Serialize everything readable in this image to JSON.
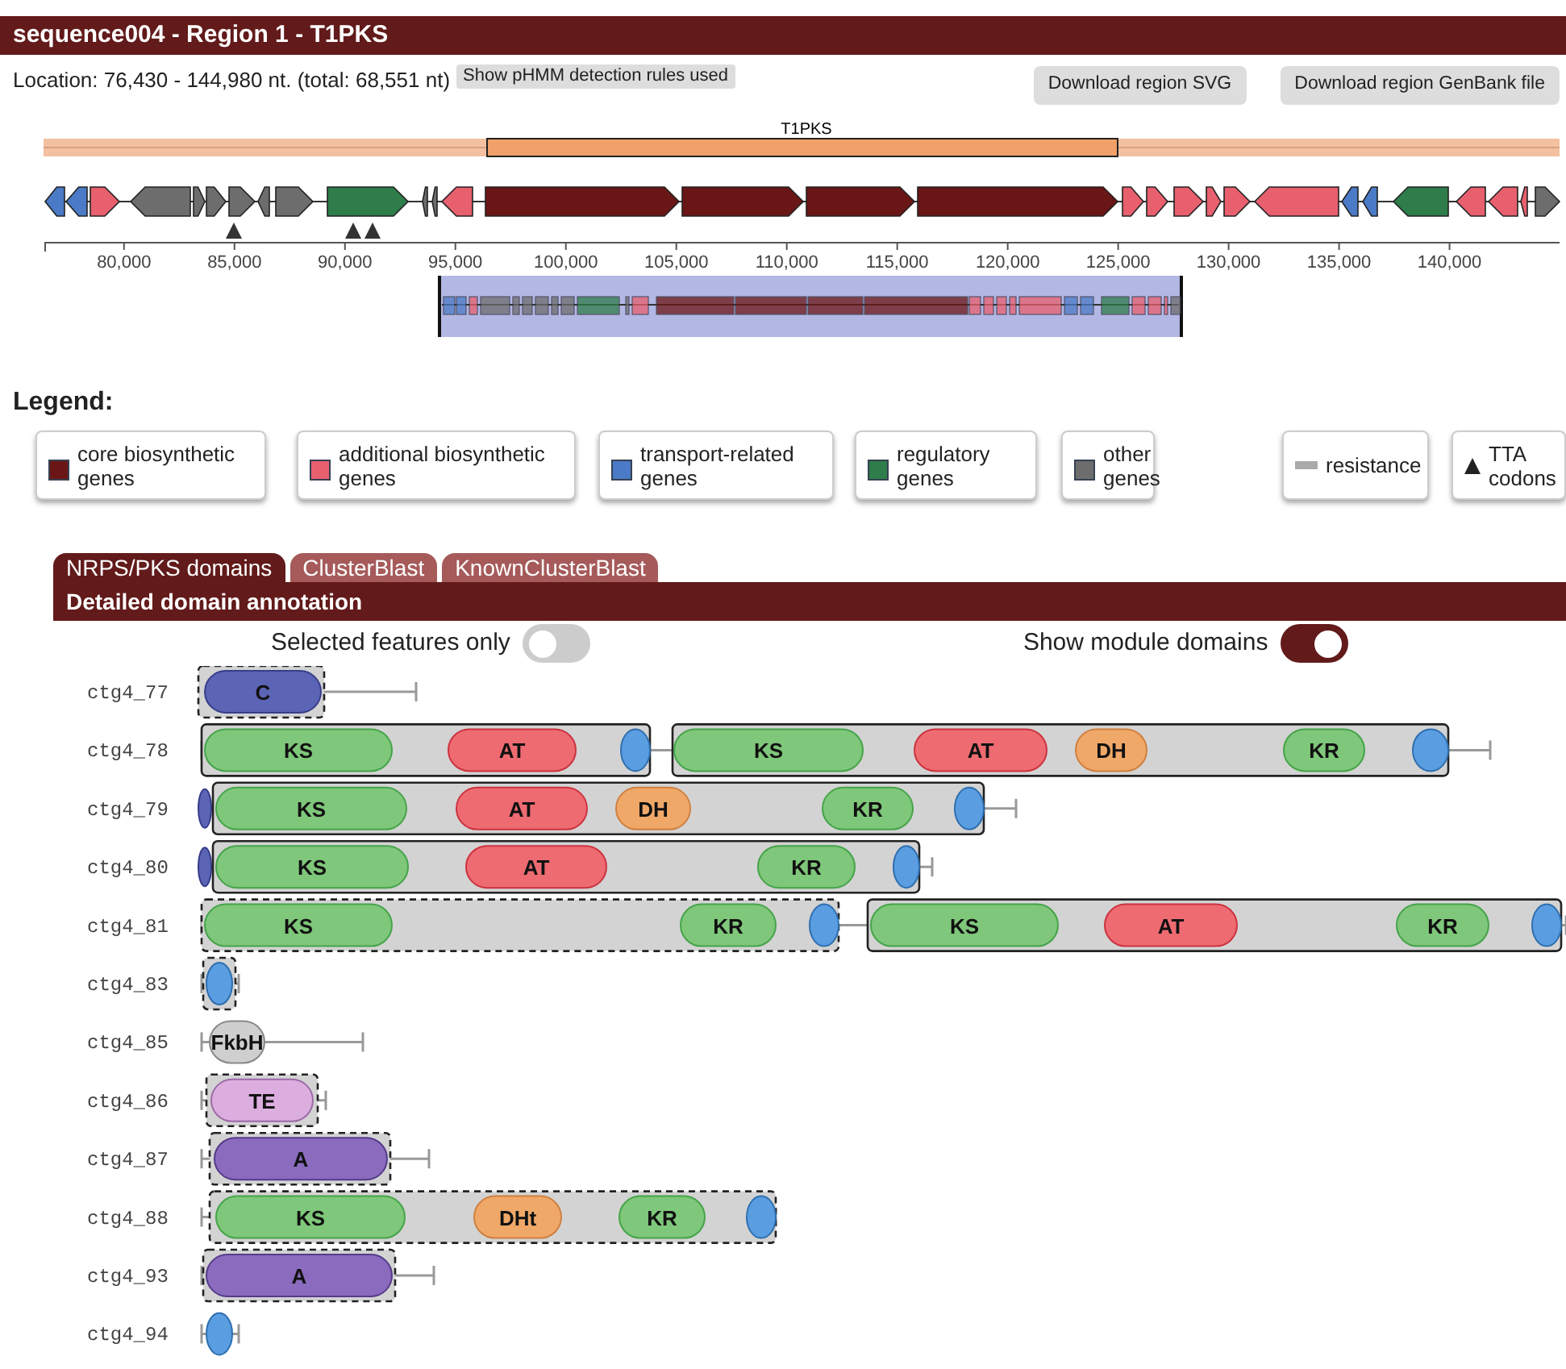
{
  "header": {
    "title": "sequence004 - Region 1 - T1PKS"
  },
  "location": {
    "text": "Location: 76,430 - 144,980 nt. (total: 68,551 nt)",
    "rules_button": "Show pHMM detection rules used"
  },
  "downloads": [
    "Download region SVG",
    "Download region GenBank file"
  ],
  "region": {
    "protocluster": "T1PKS",
    "ticks": [
      "80,000",
      "85,000",
      "90,000",
      "95,000",
      "100,000",
      "105,000",
      "110,000",
      "115,000",
      "120,000",
      "125,000",
      "130,000",
      "135,000",
      "140,000"
    ]
  },
  "legend": {
    "title": "Legend:",
    "items": [
      {
        "label": "core biosynthetic genes",
        "kind": "color",
        "color": "#6b1616"
      },
      {
        "label": "additional biosynthetic genes",
        "kind": "color",
        "color": "#e8606e"
      },
      {
        "label": "transport-related genes",
        "kind": "color",
        "color": "#4b7ac6"
      },
      {
        "label": "regulatory genes",
        "kind": "color",
        "color": "#2e7d4a"
      },
      {
        "label": "other genes",
        "kind": "color",
        "color": "#6d6d6d"
      },
      {
        "label": "resistance",
        "kind": "resistance"
      },
      {
        "label": "TTA codons",
        "kind": "tta"
      }
    ]
  },
  "tabs": [
    {
      "label": "NRPS/PKS domains",
      "selected": true
    },
    {
      "label": "ClusterBlast",
      "selected": false
    },
    {
      "label": "KnownClusterBlast",
      "selected": false
    }
  ],
  "section_title": "Detailed domain annotation",
  "toggles": [
    {
      "label": "Selected features only",
      "on": false
    },
    {
      "label": "Show module domains",
      "on": true
    }
  ],
  "rows": [
    {
      "name": "ctg4_77",
      "parts": [
        {
          "kind": "module",
          "complete": false,
          "domains": [
            {
              "kind": "condensation",
              "label": "C"
            }
          ]
        }
      ]
    },
    {
      "name": "ctg4_78",
      "parts": [
        {
          "kind": "module",
          "complete": true,
          "domains": [
            {
              "kind": "ketosynthase",
              "label": "KS"
            },
            {
              "kind": "transferase",
              "label": "AT"
            },
            {
              "kind": "carrier"
            }
          ]
        },
        {
          "kind": "module",
          "complete": true,
          "domains": [
            {
              "kind": "ketosynthase",
              "label": "KS"
            },
            {
              "kind": "transferase",
              "label": "AT"
            },
            {
              "kind": "dehydratase",
              "label": "DH"
            },
            {
              "kind": "reductase",
              "label": "KR"
            },
            {
              "kind": "carrier"
            }
          ]
        }
      ]
    },
    {
      "name": "ctg4_79",
      "parts": [
        {
          "kind": "docking"
        },
        {
          "kind": "module",
          "complete": true,
          "domains": [
            {
              "kind": "ketosynthase",
              "label": "KS"
            },
            {
              "kind": "transferase",
              "label": "AT"
            },
            {
              "kind": "dehydratase",
              "label": "DH"
            },
            {
              "kind": "reductase",
              "label": "KR"
            },
            {
              "kind": "carrier"
            }
          ]
        }
      ]
    },
    {
      "name": "ctg4_80",
      "parts": [
        {
          "kind": "docking"
        },
        {
          "kind": "module",
          "complete": true,
          "domains": [
            {
              "kind": "ketosynthase",
              "label": "KS"
            },
            {
              "kind": "transferase",
              "label": "AT"
            },
            {
              "kind": "reductase",
              "label": "KR"
            },
            {
              "kind": "carrier"
            }
          ]
        }
      ]
    },
    {
      "name": "ctg4_81",
      "parts": [
        {
          "kind": "module",
          "complete": false,
          "domains": [
            {
              "kind": "ketosynthase",
              "label": "KS"
            },
            {
              "kind": "reductase",
              "label": "KR"
            },
            {
              "kind": "carrier"
            }
          ]
        },
        {
          "kind": "module",
          "complete": true,
          "domains": [
            {
              "kind": "ketosynthase",
              "label": "KS"
            },
            {
              "kind": "transferase",
              "label": "AT"
            },
            {
              "kind": "reductase",
              "label": "KR"
            },
            {
              "kind": "carrier"
            }
          ]
        }
      ]
    },
    {
      "name": "ctg4_83",
      "parts": [
        {
          "kind": "module",
          "complete": false,
          "domains": [
            {
              "kind": "carrier"
            }
          ]
        }
      ]
    },
    {
      "name": "ctg4_85",
      "parts": [
        {
          "kind": "other",
          "label": "FkbH"
        }
      ]
    },
    {
      "name": "ctg4_86",
      "parts": [
        {
          "kind": "module",
          "complete": false,
          "domains": [
            {
              "kind": "thioesterase",
              "label": "TE"
            }
          ]
        }
      ]
    },
    {
      "name": "ctg4_87",
      "parts": [
        {
          "kind": "module",
          "complete": false,
          "domains": [
            {
              "kind": "adenylation",
              "label": "A"
            }
          ]
        }
      ]
    },
    {
      "name": "ctg4_88",
      "parts": [
        {
          "kind": "module",
          "complete": false,
          "domains": [
            {
              "kind": "ketosynthase",
              "label": "KS"
            },
            {
              "kind": "dehydratase",
              "label": "DHt"
            },
            {
              "kind": "reductase",
              "label": "KR"
            },
            {
              "kind": "carrier"
            }
          ]
        }
      ]
    },
    {
      "name": "ctg4_93",
      "parts": [
        {
          "kind": "module",
          "complete": false,
          "domains": [
            {
              "kind": "adenylation",
              "label": "A"
            }
          ]
        }
      ]
    },
    {
      "name": "ctg4_94",
      "parts": [
        {
          "kind": "carrier"
        }
      ]
    }
  ]
}
